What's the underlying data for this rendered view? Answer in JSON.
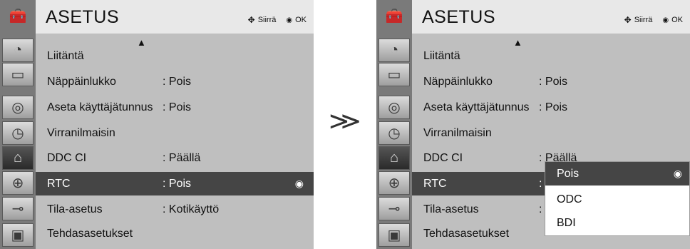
{
  "left_panel": {
    "title": "ASETUS",
    "hint_move": "Siirrä",
    "hint_ok": "OK",
    "rows": [
      {
        "label": "Liitäntä",
        "value": ""
      },
      {
        "label": "Näppäinlukko",
        "value": ": Pois"
      },
      {
        "label": "Aseta käyttäjätunnus",
        "value": ": Pois"
      },
      {
        "label": "Virranilmaisin",
        "value": ""
      },
      {
        "label": "DDC CI",
        "value": ": Päällä"
      },
      {
        "label": "RTC",
        "value": ": Pois"
      },
      {
        "label": "Tila-asetus",
        "value": ": Kotikäyttö"
      },
      {
        "label": "Tehdasasetukset",
        "value": ""
      }
    ]
  },
  "compare_symbol": "≫",
  "right_panel": {
    "title": "ASETUS",
    "hint_move": "Siirrä",
    "hint_ok": "OK",
    "rows": [
      {
        "label": "Liitäntä",
        "value": ""
      },
      {
        "label": "Näppäinlukko",
        "value": ": Pois"
      },
      {
        "label": "Aseta käyttäjätunnus",
        "value": ": Pois"
      },
      {
        "label": "Virranilmaisin",
        "value": ""
      },
      {
        "label": "DDC CI",
        "value": ": Päällä"
      },
      {
        "label": "RTC",
        "value": ":"
      },
      {
        "label": "Tila-asetus",
        "value": ":"
      },
      {
        "label": "Tehdasasetukset",
        "value": ""
      }
    ],
    "dropdown_options": [
      "Pois",
      "ODC",
      "BDI"
    ],
    "dropdown_selected": "Pois"
  },
  "icons": [
    "toolbox-icon",
    "antenna-icon",
    "monitor-icon",
    "speaker-icon",
    "clock-icon",
    "toolbox-icon",
    "lock-icon",
    "plug-icon",
    "photo-icon"
  ],
  "colors": {
    "selected_row": "#454545",
    "menu_bg": "#bfbfbf",
    "header_bg": "#e8e8e8"
  }
}
